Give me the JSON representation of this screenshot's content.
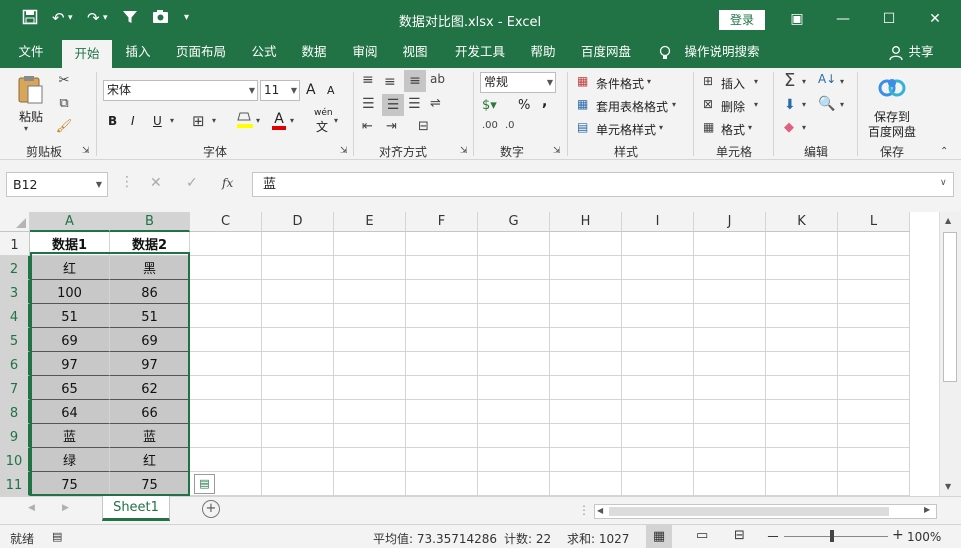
{
  "titlebar": {
    "title": "数据对比图.xlsx  -  Excel",
    "login": "登录",
    "qa_icons": [
      "save-icon",
      "undo-icon",
      "redo-icon",
      "filter-icon",
      "camera-icon",
      "customize-icon"
    ]
  },
  "tabs": [
    "文件",
    "开始",
    "插入",
    "页面布局",
    "公式",
    "数据",
    "审阅",
    "视图",
    "开发工具",
    "帮助",
    "百度网盘",
    "操作说明搜索",
    "共享"
  ],
  "ribbon": {
    "clipboard": {
      "paste": "粘贴",
      "label": "剪贴板"
    },
    "font": {
      "name": "宋体",
      "size": "11",
      "bold": "B",
      "italic": "I",
      "underline": "U",
      "label": "字体",
      "grow": "A",
      "shrink": "A",
      "color_a": "A",
      "wen": "wén",
      "wen_char": "文"
    },
    "align": {
      "label": "对齐方式"
    },
    "number": {
      "format": "常规",
      "percent": "%",
      "comma": ",",
      "label": "数字"
    },
    "styles": {
      "cond": "条件格式",
      "table": "套用表格格式",
      "cell": "单元格样式",
      "label": "样式"
    },
    "cells": {
      "insert": "插入",
      "delete": "删除",
      "format": "格式",
      "label": "单元格"
    },
    "edit": {
      "label": "编辑"
    },
    "save": {
      "line1": "保存到",
      "line2": "百度网盘",
      "label": "保存"
    }
  },
  "formula": {
    "namebox": "B12",
    "cancel": "✕",
    "enter": "✓",
    "fx": "fx",
    "value": "蓝"
  },
  "grid": {
    "columns": [
      "A",
      "B",
      "C",
      "D",
      "E",
      "F",
      "G",
      "H",
      "I",
      "J",
      "K",
      "L"
    ],
    "rows": [
      [
        "数据1",
        "数据2"
      ],
      [
        "红",
        "黑"
      ],
      [
        "100",
        "86"
      ],
      [
        "51",
        "51"
      ],
      [
        "69",
        "69"
      ],
      [
        "97",
        "97"
      ],
      [
        "65",
        "62"
      ],
      [
        "64",
        "66"
      ],
      [
        "蓝",
        "蓝"
      ],
      [
        "绿",
        "红"
      ],
      [
        "75",
        "75"
      ]
    ],
    "row_numbers": [
      "1",
      "2",
      "3",
      "4",
      "5",
      "6",
      "7",
      "8",
      "9",
      "10",
      "11"
    ]
  },
  "sheets": {
    "active": "Sheet1",
    "add": "+"
  },
  "status": {
    "mode": "就绪",
    "average": "平均值: 73.35714286",
    "count": "计数: 22",
    "sum": "求和: 1027",
    "zoom": "100%",
    "zoom_minus": "－",
    "zoom_plus": "+"
  },
  "colors": {
    "accent": "#217346",
    "shade": "#c8c8c8"
  }
}
